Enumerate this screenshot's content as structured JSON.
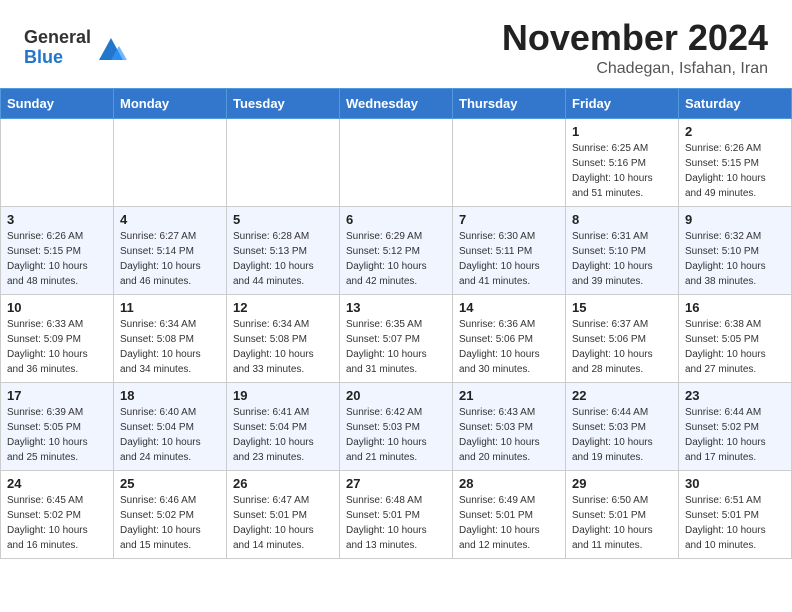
{
  "header": {
    "logo_general": "General",
    "logo_blue": "Blue",
    "month": "November 2024",
    "location": "Chadegan, Isfahan, Iran"
  },
  "weekdays": [
    "Sunday",
    "Monday",
    "Tuesday",
    "Wednesday",
    "Thursday",
    "Friday",
    "Saturday"
  ],
  "weeks": [
    [
      {
        "day": "",
        "info": ""
      },
      {
        "day": "",
        "info": ""
      },
      {
        "day": "",
        "info": ""
      },
      {
        "day": "",
        "info": ""
      },
      {
        "day": "",
        "info": ""
      },
      {
        "day": "1",
        "info": "Sunrise: 6:25 AM\nSunset: 5:16 PM\nDaylight: 10 hours\nand 51 minutes."
      },
      {
        "day": "2",
        "info": "Sunrise: 6:26 AM\nSunset: 5:15 PM\nDaylight: 10 hours\nand 49 minutes."
      }
    ],
    [
      {
        "day": "3",
        "info": "Sunrise: 6:26 AM\nSunset: 5:15 PM\nDaylight: 10 hours\nand 48 minutes."
      },
      {
        "day": "4",
        "info": "Sunrise: 6:27 AM\nSunset: 5:14 PM\nDaylight: 10 hours\nand 46 minutes."
      },
      {
        "day": "5",
        "info": "Sunrise: 6:28 AM\nSunset: 5:13 PM\nDaylight: 10 hours\nand 44 minutes."
      },
      {
        "day": "6",
        "info": "Sunrise: 6:29 AM\nSunset: 5:12 PM\nDaylight: 10 hours\nand 42 minutes."
      },
      {
        "day": "7",
        "info": "Sunrise: 6:30 AM\nSunset: 5:11 PM\nDaylight: 10 hours\nand 41 minutes."
      },
      {
        "day": "8",
        "info": "Sunrise: 6:31 AM\nSunset: 5:10 PM\nDaylight: 10 hours\nand 39 minutes."
      },
      {
        "day": "9",
        "info": "Sunrise: 6:32 AM\nSunset: 5:10 PM\nDaylight: 10 hours\nand 38 minutes."
      }
    ],
    [
      {
        "day": "10",
        "info": "Sunrise: 6:33 AM\nSunset: 5:09 PM\nDaylight: 10 hours\nand 36 minutes."
      },
      {
        "day": "11",
        "info": "Sunrise: 6:34 AM\nSunset: 5:08 PM\nDaylight: 10 hours\nand 34 minutes."
      },
      {
        "day": "12",
        "info": "Sunrise: 6:34 AM\nSunset: 5:08 PM\nDaylight: 10 hours\nand 33 minutes."
      },
      {
        "day": "13",
        "info": "Sunrise: 6:35 AM\nSunset: 5:07 PM\nDaylight: 10 hours\nand 31 minutes."
      },
      {
        "day": "14",
        "info": "Sunrise: 6:36 AM\nSunset: 5:06 PM\nDaylight: 10 hours\nand 30 minutes."
      },
      {
        "day": "15",
        "info": "Sunrise: 6:37 AM\nSunset: 5:06 PM\nDaylight: 10 hours\nand 28 minutes."
      },
      {
        "day": "16",
        "info": "Sunrise: 6:38 AM\nSunset: 5:05 PM\nDaylight: 10 hours\nand 27 minutes."
      }
    ],
    [
      {
        "day": "17",
        "info": "Sunrise: 6:39 AM\nSunset: 5:05 PM\nDaylight: 10 hours\nand 25 minutes."
      },
      {
        "day": "18",
        "info": "Sunrise: 6:40 AM\nSunset: 5:04 PM\nDaylight: 10 hours\nand 24 minutes."
      },
      {
        "day": "19",
        "info": "Sunrise: 6:41 AM\nSunset: 5:04 PM\nDaylight: 10 hours\nand 23 minutes."
      },
      {
        "day": "20",
        "info": "Sunrise: 6:42 AM\nSunset: 5:03 PM\nDaylight: 10 hours\nand 21 minutes."
      },
      {
        "day": "21",
        "info": "Sunrise: 6:43 AM\nSunset: 5:03 PM\nDaylight: 10 hours\nand 20 minutes."
      },
      {
        "day": "22",
        "info": "Sunrise: 6:44 AM\nSunset: 5:03 PM\nDaylight: 10 hours\nand 19 minutes."
      },
      {
        "day": "23",
        "info": "Sunrise: 6:44 AM\nSunset: 5:02 PM\nDaylight: 10 hours\nand 17 minutes."
      }
    ],
    [
      {
        "day": "24",
        "info": "Sunrise: 6:45 AM\nSunset: 5:02 PM\nDaylight: 10 hours\nand 16 minutes."
      },
      {
        "day": "25",
        "info": "Sunrise: 6:46 AM\nSunset: 5:02 PM\nDaylight: 10 hours\nand 15 minutes."
      },
      {
        "day": "26",
        "info": "Sunrise: 6:47 AM\nSunset: 5:01 PM\nDaylight: 10 hours\nand 14 minutes."
      },
      {
        "day": "27",
        "info": "Sunrise: 6:48 AM\nSunset: 5:01 PM\nDaylight: 10 hours\nand 13 minutes."
      },
      {
        "day": "28",
        "info": "Sunrise: 6:49 AM\nSunset: 5:01 PM\nDaylight: 10 hours\nand 12 minutes."
      },
      {
        "day": "29",
        "info": "Sunrise: 6:50 AM\nSunset: 5:01 PM\nDaylight: 10 hours\nand 11 minutes."
      },
      {
        "day": "30",
        "info": "Sunrise: 6:51 AM\nSunset: 5:01 PM\nDaylight: 10 hours\nand 10 minutes."
      }
    ]
  ]
}
